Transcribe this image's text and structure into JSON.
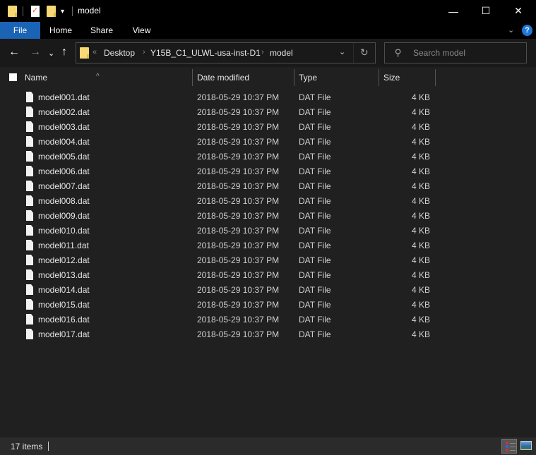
{
  "window": {
    "title": "model",
    "controls": {
      "minimize": "—",
      "maximize": "☐",
      "close": "✕"
    }
  },
  "quick_access": {
    "icons": [
      "folder-icon",
      "properties-icon",
      "new-folder-icon",
      "customize-dropdown-icon"
    ]
  },
  "ribbon": {
    "tabs": [
      {
        "label": "File",
        "active": true
      },
      {
        "label": "Home"
      },
      {
        "label": "Share"
      },
      {
        "label": "View"
      }
    ],
    "expand_icon": "⌄",
    "help_label": "?"
  },
  "navigation": {
    "back": "←",
    "forward": "→",
    "recent": "⌄",
    "up": "↑",
    "breadcrumb": {
      "overflow": "«",
      "items": [
        "Desktop",
        "Y15B_C1_ULWL-usa-inst-D1",
        "model"
      ],
      "separator": "›"
    },
    "dropdown": "⌄",
    "refresh": "↻",
    "search": {
      "placeholder": "Search model",
      "value": ""
    }
  },
  "columns": [
    {
      "label": "Name",
      "sorted": "ascending"
    },
    {
      "label": "Date modified"
    },
    {
      "label": "Type"
    },
    {
      "label": "Size"
    }
  ],
  "files": [
    {
      "name": "model001.dat",
      "date": "2018-05-29 10:37 PM",
      "type": "DAT File",
      "size": "4 KB"
    },
    {
      "name": "model002.dat",
      "date": "2018-05-29 10:37 PM",
      "type": "DAT File",
      "size": "4 KB"
    },
    {
      "name": "model003.dat",
      "date": "2018-05-29 10:37 PM",
      "type": "DAT File",
      "size": "4 KB"
    },
    {
      "name": "model004.dat",
      "date": "2018-05-29 10:37 PM",
      "type": "DAT File",
      "size": "4 KB"
    },
    {
      "name": "model005.dat",
      "date": "2018-05-29 10:37 PM",
      "type": "DAT File",
      "size": "4 KB"
    },
    {
      "name": "model006.dat",
      "date": "2018-05-29 10:37 PM",
      "type": "DAT File",
      "size": "4 KB"
    },
    {
      "name": "model007.dat",
      "date": "2018-05-29 10:37 PM",
      "type": "DAT File",
      "size": "4 KB"
    },
    {
      "name": "model008.dat",
      "date": "2018-05-29 10:37 PM",
      "type": "DAT File",
      "size": "4 KB"
    },
    {
      "name": "model009.dat",
      "date": "2018-05-29 10:37 PM",
      "type": "DAT File",
      "size": "4 KB"
    },
    {
      "name": "model010.dat",
      "date": "2018-05-29 10:37 PM",
      "type": "DAT File",
      "size": "4 KB"
    },
    {
      "name": "model011.dat",
      "date": "2018-05-29 10:37 PM",
      "type": "DAT File",
      "size": "4 KB"
    },
    {
      "name": "model012.dat",
      "date": "2018-05-29 10:37 PM",
      "type": "DAT File",
      "size": "4 KB"
    },
    {
      "name": "model013.dat",
      "date": "2018-05-29 10:37 PM",
      "type": "DAT File",
      "size": "4 KB"
    },
    {
      "name": "model014.dat",
      "date": "2018-05-29 10:37 PM",
      "type": "DAT File",
      "size": "4 KB"
    },
    {
      "name": "model015.dat",
      "date": "2018-05-29 10:37 PM",
      "type": "DAT File",
      "size": "4 KB"
    },
    {
      "name": "model016.dat",
      "date": "2018-05-29 10:37 PM",
      "type": "DAT File",
      "size": "4 KB"
    },
    {
      "name": "model017.dat",
      "date": "2018-05-29 10:37 PM",
      "type": "DAT File",
      "size": "4 KB"
    }
  ],
  "status": {
    "item_count": "17 items"
  },
  "colors": {
    "accent": "#1b63b5",
    "background": "#202020",
    "titlebar": "#000000",
    "folder": "#f8d775"
  }
}
